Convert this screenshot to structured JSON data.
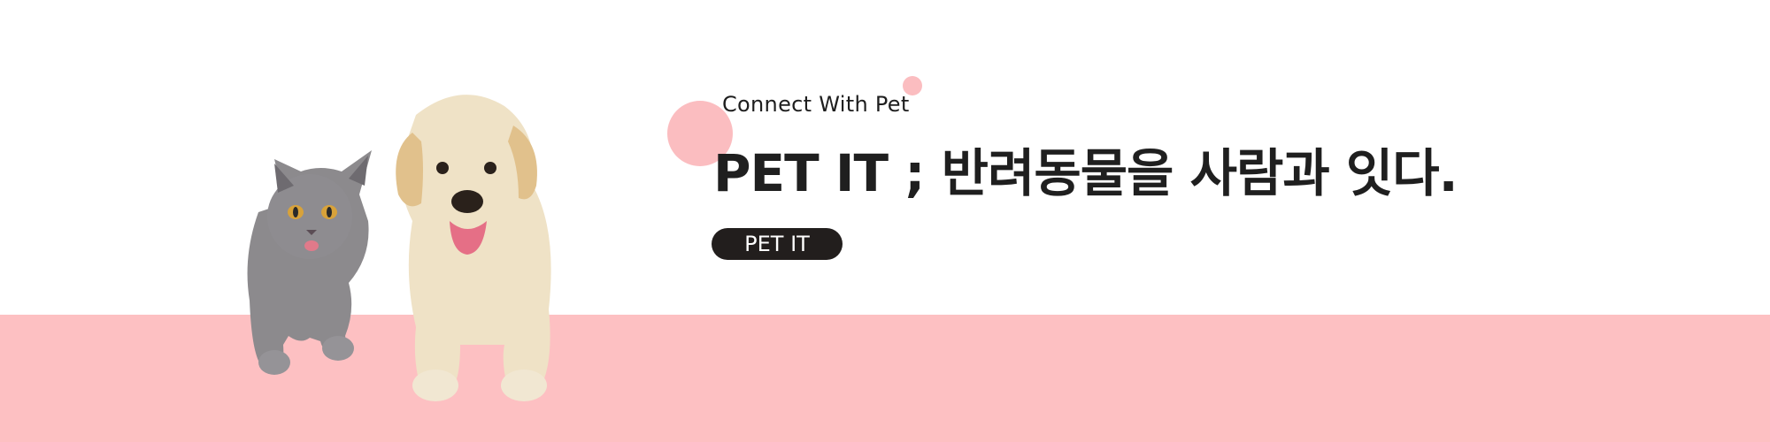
{
  "banner": {
    "tagline": "Connect With Pet",
    "headline": "PET IT ; 반려동물을 사람과 잇다.",
    "cta_label": "PET IT",
    "image": "cat-and-dog-illustration"
  },
  "colors": {
    "band": "#fdc0c2",
    "accent_circle": "#fbbdc0",
    "button": "#221e1d",
    "text": "#1f1f1f"
  }
}
